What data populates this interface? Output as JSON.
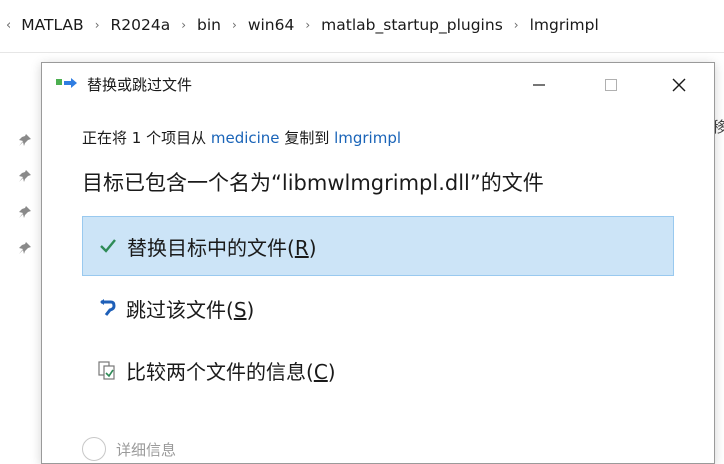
{
  "breadcrumb": {
    "lead_glyph": "‹",
    "items": [
      "MATLAB",
      "R2024a",
      "bin",
      "win64",
      "matlab_startup_plugins",
      "lmgrimpl"
    ],
    "separator": "›"
  },
  "explorer": {
    "edge_glyph": "移"
  },
  "dialog": {
    "title": "替换或跳过文件",
    "controls": {
      "minimize": "—",
      "maximize": "☐",
      "close": "✕"
    },
    "subline": {
      "prefix": "正在将 1 个项目从 ",
      "source": "medicine",
      "middle": " 复制到 ",
      "dest": "lmgrimpl"
    },
    "headline": "目标已包含一个名为“libmwlmgrimpl.dll”的文件",
    "options": [
      {
        "label": "替换目标中的文件(",
        "accel": "R",
        "suffix": ")",
        "icon": "check-icon"
      },
      {
        "label": "跳过该文件(",
        "accel": "S",
        "suffix": ")",
        "icon": "skip-icon"
      },
      {
        "label": "比较两个文件的信息(",
        "accel": "C",
        "suffix": ")",
        "icon": "compare-icon"
      }
    ],
    "details": {
      "label": "详细信息"
    }
  },
  "colors": {
    "accent_link": "#1a64b8",
    "selected_bg": "#cce4f7",
    "check_green": "#2e8b57",
    "skip_blue": "#1e5fb8"
  }
}
